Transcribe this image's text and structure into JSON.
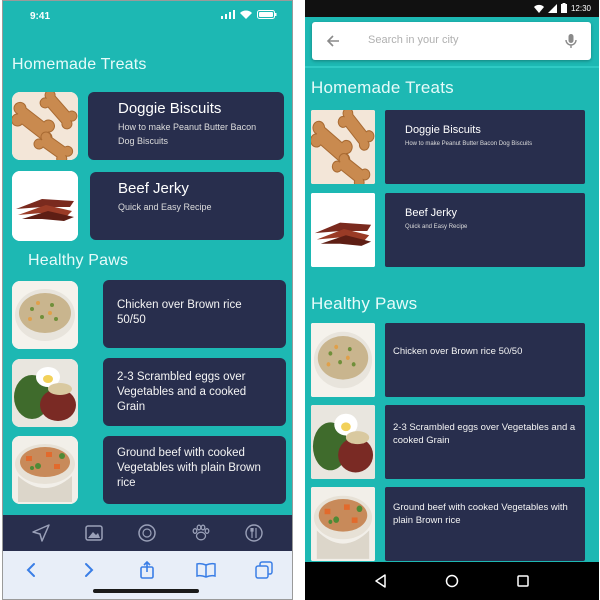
{
  "ios": {
    "status_time": "9:41",
    "sections": [
      {
        "title": "Homemade Treats",
        "items": [
          {
            "title": "Doggie Biscuits",
            "subtitle": "How to make Peanut Butter Bacon Dog Biscuits",
            "image": "dog-biscuits-image"
          },
          {
            "title": "Beef Jerky",
            "subtitle": "Quick and Easy Recipe",
            "image": "beef-jerky-image"
          }
        ]
      },
      {
        "title": "Healthy Paws",
        "items": [
          {
            "body": "Chicken over Brown rice 50/50",
            "image": "chicken-rice-image"
          },
          {
            "body": "2-3 Scrambled eggs over Vegetables and a cooked Grain",
            "image": "eggs-vegetables-image"
          },
          {
            "body": "Ground beef with cooked Vegetables with plain Brown rice",
            "image": "ground-beef-image"
          }
        ]
      }
    ],
    "tabbar_icons": [
      "navigation-arrow-icon",
      "photo-icon",
      "chat-bubble-icon",
      "paw-icon",
      "utensils-icon"
    ],
    "safari_icons": [
      "back-chevron-icon",
      "forward-chevron-icon",
      "share-icon",
      "bookmarks-icon",
      "tabs-icon"
    ]
  },
  "android": {
    "status_time": "12:30",
    "search_placeholder": "Search in your city",
    "sections": [
      {
        "title": "Homemade Treats",
        "items": [
          {
            "title": "Doggie Biscuits",
            "subtitle": "How to make Peanut Butter Bacon Dog Biscuits",
            "image": "dog-biscuits-image"
          },
          {
            "title": "Beef Jerky",
            "subtitle": "Quick and Easy Recipe",
            "image": "beef-jerky-image"
          }
        ]
      },
      {
        "title": "Healthy Paws",
        "items": [
          {
            "body": "Chicken over Brown rice 50/50",
            "image": "chicken-rice-image"
          },
          {
            "body": "2-3 Scrambled eggs over Vegetables and a cooked Grain",
            "image": "eggs-vegetables-image"
          },
          {
            "body": "Ground beef with cooked Vegetables with plain Brown rice",
            "image": "ground-beef-image"
          }
        ]
      }
    ],
    "navbar_icons": [
      "back-triangle-icon",
      "home-circle-icon",
      "recents-square-icon"
    ]
  },
  "colors": {
    "teal_background": "#1db8b3",
    "card_navy": "#282e4d",
    "section_title": "#e6fbfa"
  }
}
